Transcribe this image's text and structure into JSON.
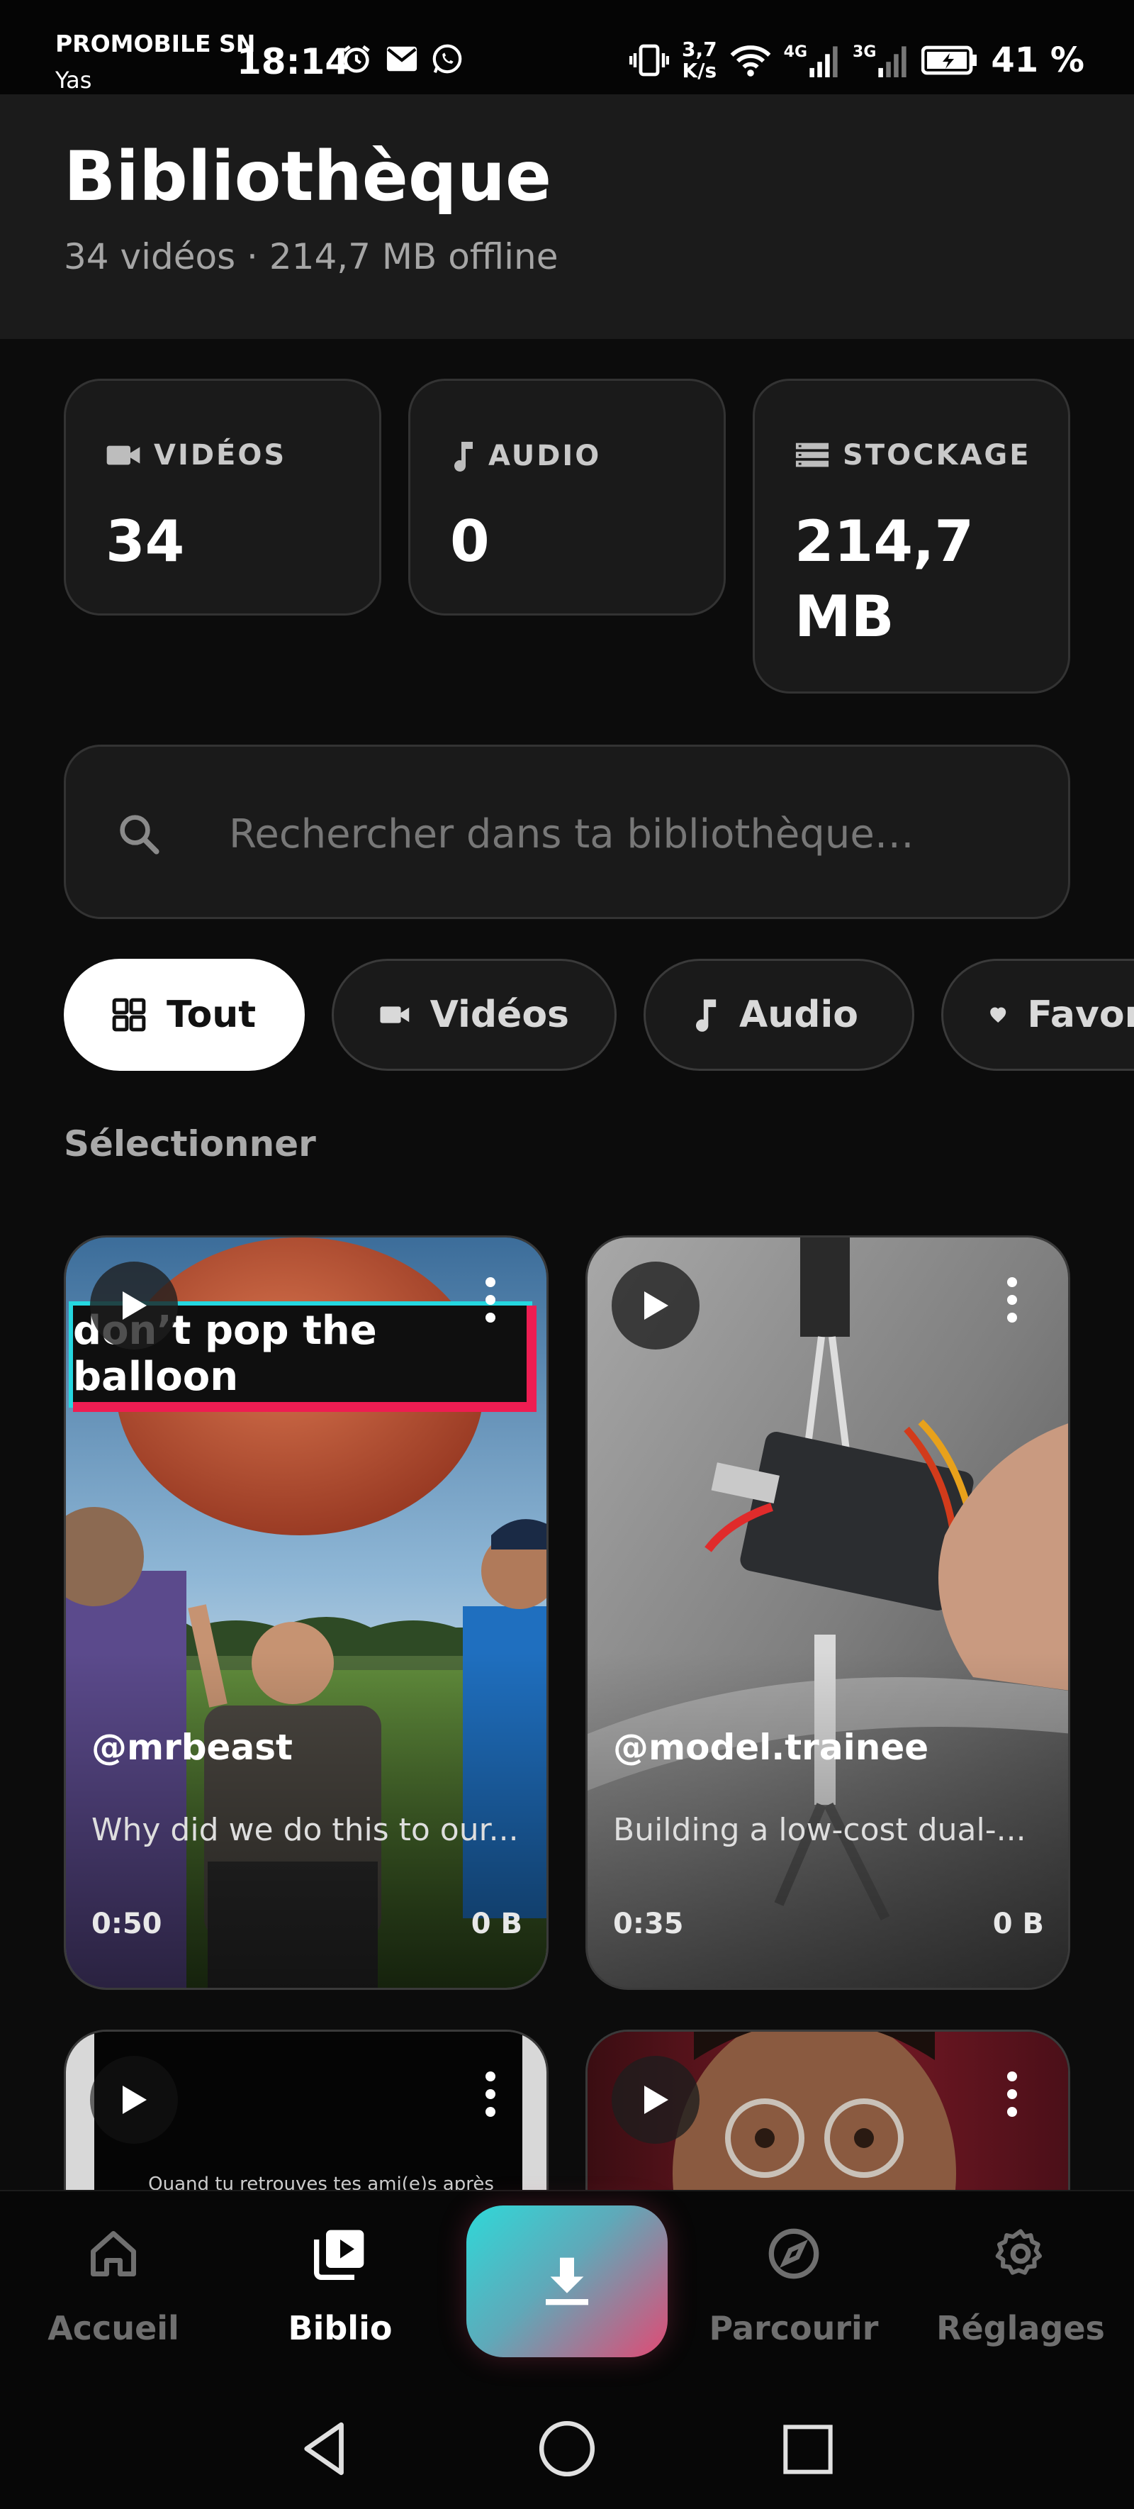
{
  "status_bar": {
    "carrier_line1": "PROMOBILE SN",
    "carrier_line2": "Yas",
    "time": "18:14",
    "speed_value": "3,7",
    "speed_unit": "K/s",
    "net1": "4G",
    "net2": "3G",
    "battery_pct": "41 %",
    "icons_left": [
      "alarm-icon",
      "mail-icon",
      "whatsapp-icon"
    ],
    "icons_right": [
      "vibrate-icon",
      "wifi-icon",
      "signal-icon",
      "signal-icon",
      "battery-charging-icon"
    ]
  },
  "header": {
    "title": "Bibliothèque",
    "subtitle": "34 vidéos · 214,7 MB offline"
  },
  "stats": [
    {
      "label": "VIDÉOS",
      "value": "34",
      "icon": "video-camera-icon"
    },
    {
      "label": "AUDIO",
      "value": "0",
      "icon": "music-note-icon"
    },
    {
      "label": "STOCKAGE",
      "value": "214,7 MB",
      "icon": "storage-icon"
    }
  ],
  "search": {
    "placeholder": "Rechercher dans ta bibliothèque…",
    "value": ""
  },
  "filters": [
    {
      "label": "Tout",
      "icon": "grid-icon",
      "active": true
    },
    {
      "label": "Vidéos",
      "icon": "video-camera-icon",
      "active": false
    },
    {
      "label": "Audio",
      "icon": "music-note-icon",
      "active": false
    },
    {
      "label": "Favoris",
      "icon": "heart-icon",
      "active": false
    }
  ],
  "select_label": "Sélectionner",
  "videos": [
    {
      "author": "@mrbeast",
      "description": "Why did we do this to our...",
      "duration": "0:50",
      "size": "0 B",
      "overlay_title": "don’t pop the balloon"
    },
    {
      "author": "@model.trainee",
      "description": "Building a low-cost dual-...",
      "duration": "0:35",
      "size": "0 B"
    },
    {
      "caption": "Quand tu retrouves tes ami(e)s après après"
    },
    {}
  ],
  "bottom_nav": {
    "items": [
      {
        "label": "Accueil",
        "icon": "home-icon",
        "active": false
      },
      {
        "label": "Biblio",
        "icon": "library-icon",
        "active": true
      },
      {
        "label": "Parcourir",
        "icon": "compass-icon",
        "active": false
      },
      {
        "label": "Réglages",
        "icon": "gear-icon",
        "active": false
      }
    ],
    "fab_icon": "download-icon"
  },
  "colors": {
    "background": "#0c0c0c",
    "card": "#1a1a1a",
    "fab_start": "#2fd8d8",
    "fab_end": "#e14a74"
  }
}
